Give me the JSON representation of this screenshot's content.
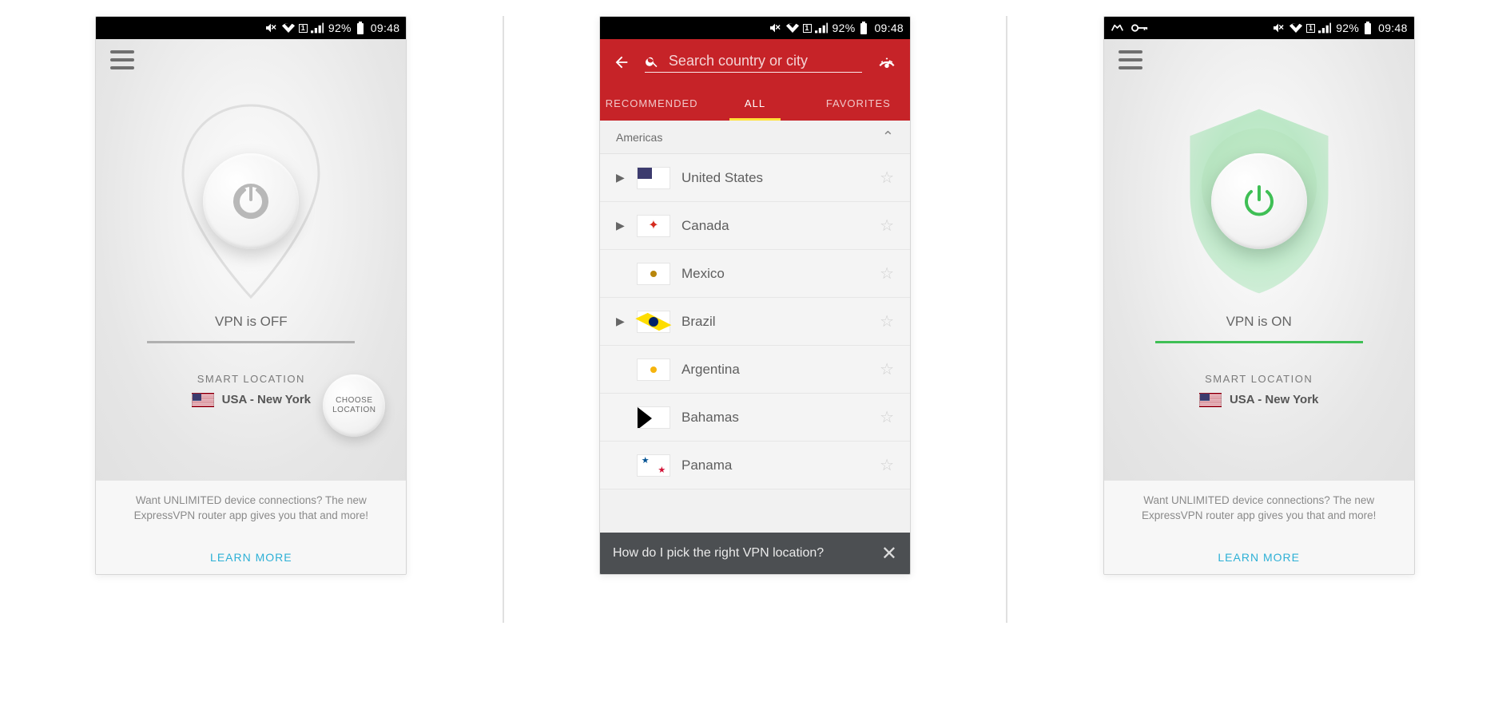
{
  "statusbar": {
    "battery_pct": "92%",
    "time": "09:48"
  },
  "screen1": {
    "vpn_status": "VPN is OFF",
    "smart_location_label": "SMART LOCATION",
    "location_name": "USA - New York",
    "choose_btn": "CHOOSE LOCATION",
    "show_choose_btn": true,
    "connected": false
  },
  "screen3": {
    "vpn_status": "VPN is ON",
    "smart_location_label": "SMART LOCATION",
    "location_name": "USA - New York",
    "connected": true
  },
  "promo": {
    "text": "Want UNLIMITED device connections? The new ExpressVPN router app gives you that and more!",
    "link": "LEARN MORE"
  },
  "screen2": {
    "search_placeholder": "Search country or city",
    "tabs": {
      "rec": "RECOMMENDED",
      "all": "ALL",
      "fav": "FAVORITES"
    },
    "active_tab": "ALL",
    "region_header": "Americas",
    "countries": [
      {
        "name": "United States",
        "flag": "flag-us",
        "expandable": true
      },
      {
        "name": "Canada",
        "flag": "flag-ca",
        "expandable": true
      },
      {
        "name": "Mexico",
        "flag": "flag-mx",
        "expandable": false
      },
      {
        "name": "Brazil",
        "flag": "flag-br",
        "expandable": true
      },
      {
        "name": "Argentina",
        "flag": "flag-ar",
        "expandable": false
      },
      {
        "name": "Bahamas",
        "flag": "flag-bs",
        "expandable": false
      },
      {
        "name": "Panama",
        "flag": "flag-pa",
        "expandable": false
      }
    ],
    "tip": "How do I pick the right VPN location?"
  },
  "colors": {
    "accent_red": "#c62328",
    "accent_green": "#3fbf55",
    "link_blue": "#2db0d6"
  }
}
